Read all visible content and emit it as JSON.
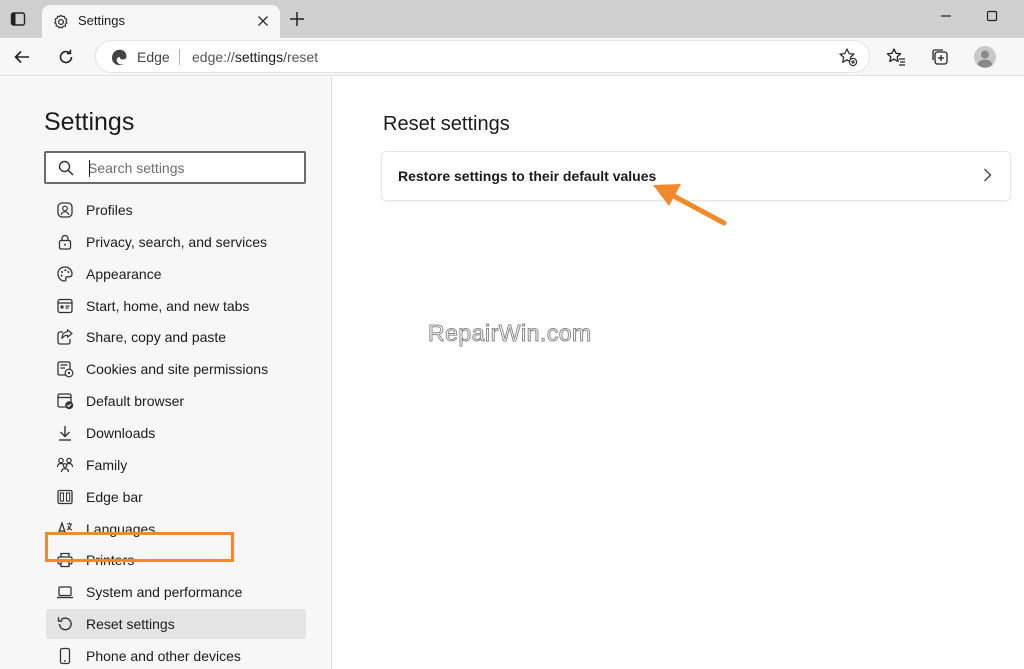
{
  "tab": {
    "title": "Settings"
  },
  "toolbar": {
    "site_name": "Edge",
    "url_scheme": "edge://",
    "url_host": "settings",
    "url_path": "/reset"
  },
  "sidebar": {
    "title": "Settings",
    "search_placeholder": "Search settings",
    "items": [
      {
        "label": "Profiles",
        "icon": "profile-icon"
      },
      {
        "label": "Privacy, search, and services",
        "icon": "lock-icon"
      },
      {
        "label": "Appearance",
        "icon": "palette-icon"
      },
      {
        "label": "Start, home, and new tabs",
        "icon": "start-page-icon"
      },
      {
        "label": "Share, copy and paste",
        "icon": "share-icon"
      },
      {
        "label": "Cookies and site permissions",
        "icon": "cookies-icon"
      },
      {
        "label": "Default browser",
        "icon": "default-browser-icon"
      },
      {
        "label": "Downloads",
        "icon": "download-icon"
      },
      {
        "label": "Family",
        "icon": "family-icon"
      },
      {
        "label": "Edge bar",
        "icon": "edge-bar-icon"
      },
      {
        "label": "Languages",
        "icon": "languages-icon"
      },
      {
        "label": "Printers",
        "icon": "printer-icon"
      },
      {
        "label": "System and performance",
        "icon": "laptop-icon"
      },
      {
        "label": "Reset settings",
        "icon": "reset-icon",
        "active": true
      },
      {
        "label": "Phone and other devices",
        "icon": "phone-icon"
      }
    ]
  },
  "main": {
    "title": "Reset settings",
    "card_label": "Restore settings to their default values"
  },
  "watermark": "RepairWin.com",
  "colors": {
    "highlight": "#f08a2b",
    "tabstrip": "#cfcfcf",
    "sidebar_bg": "#f7f7f7"
  }
}
